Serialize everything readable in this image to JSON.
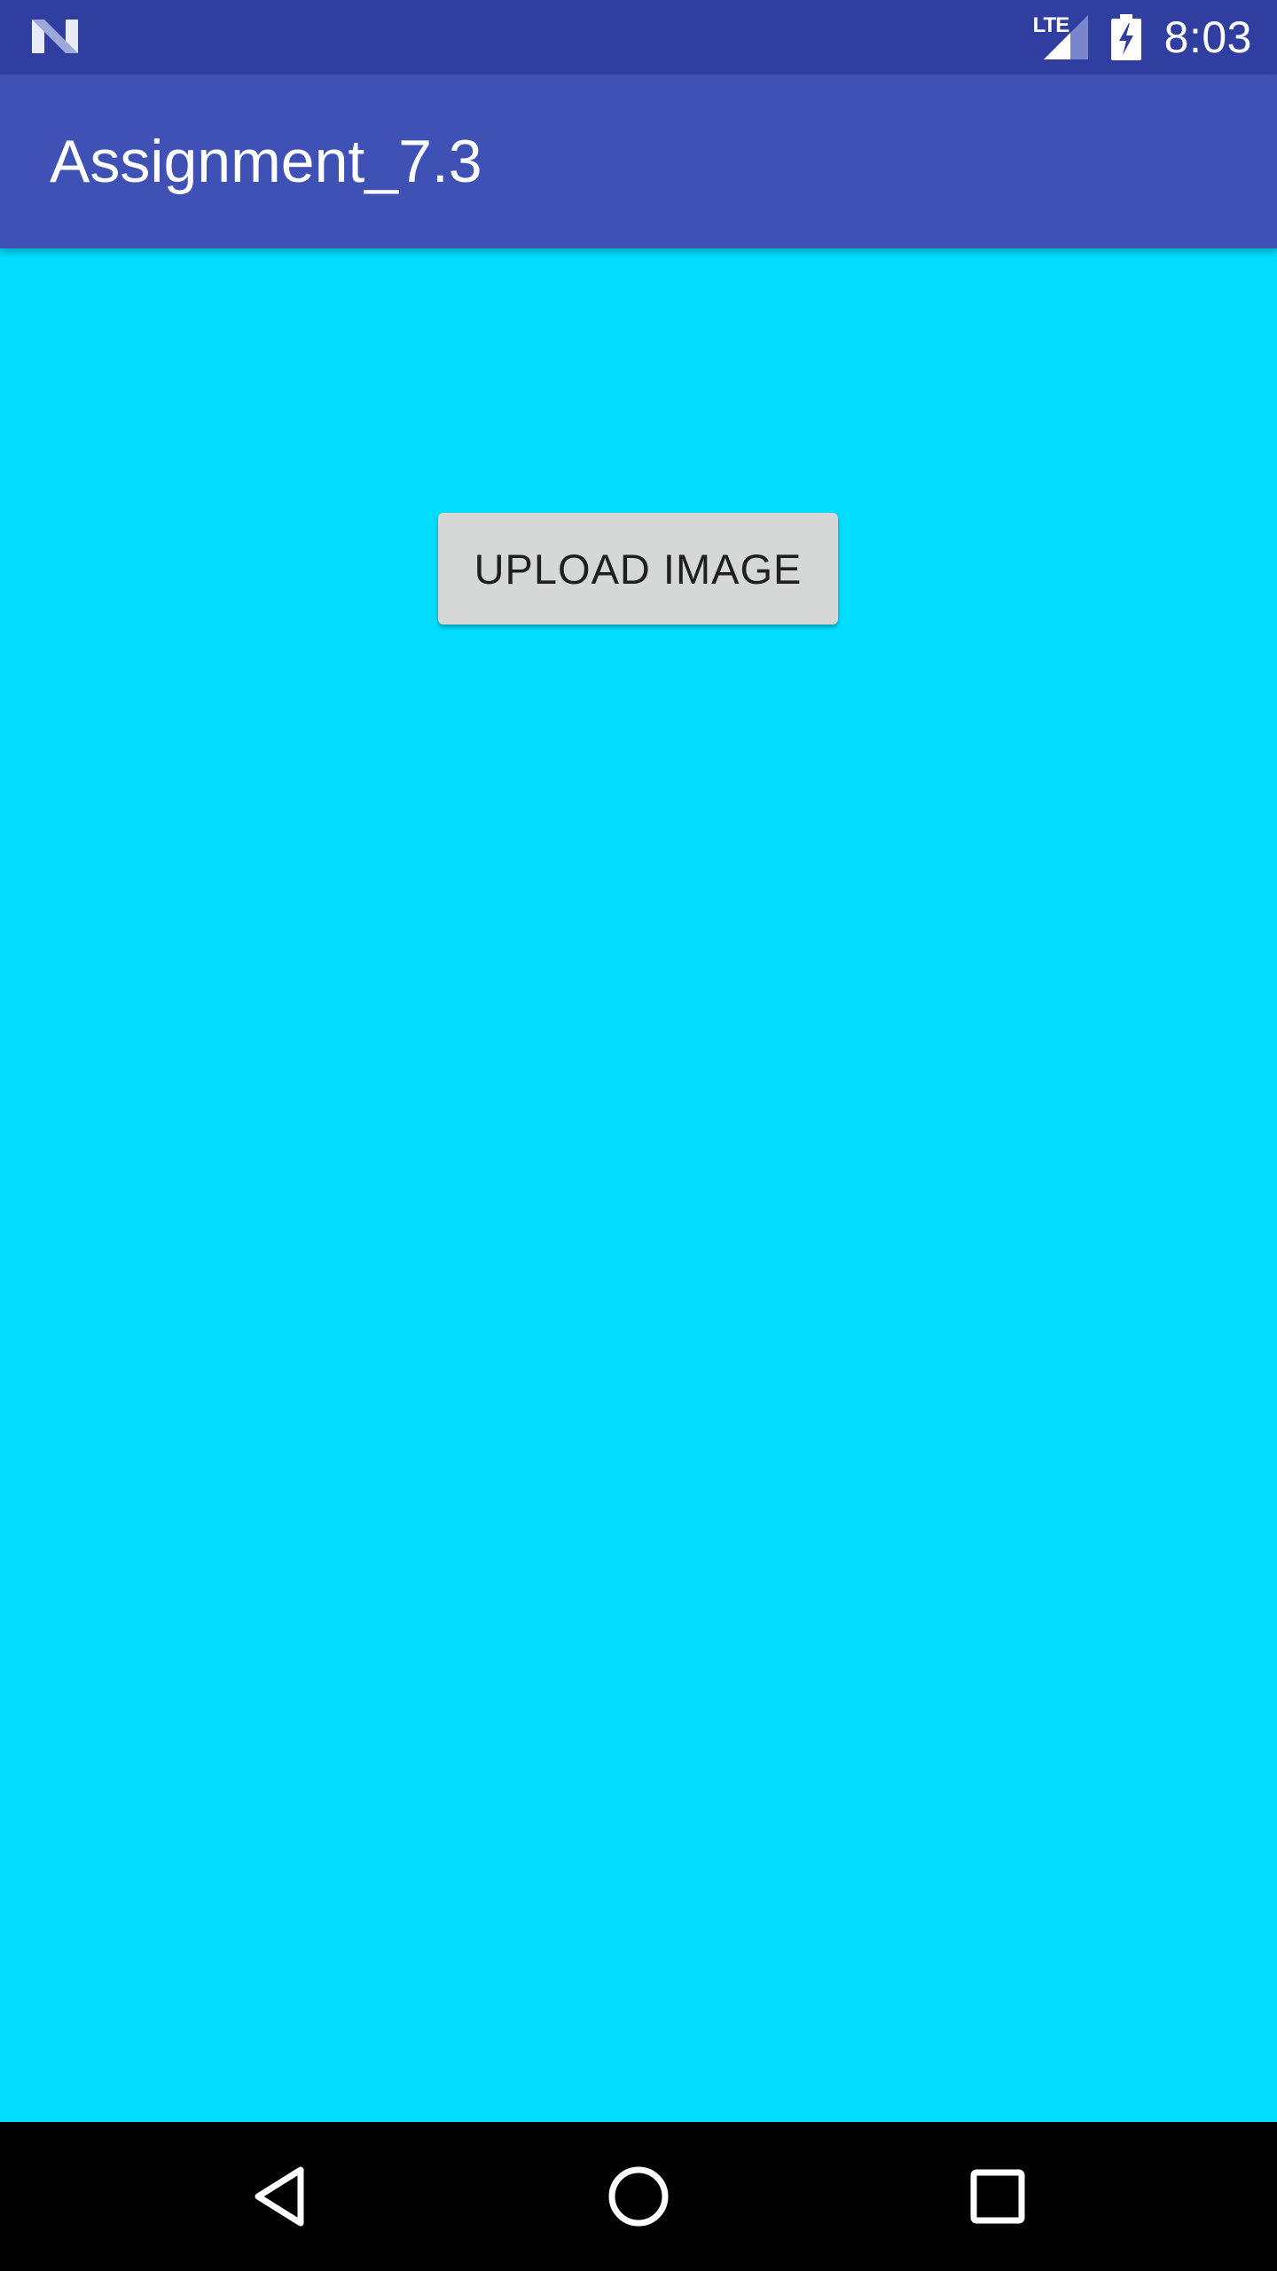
{
  "status_bar": {
    "notification_icon": "android-n-icon",
    "network_label": "LTE",
    "signal_icon": "signal-icon",
    "battery_icon": "battery-charging-icon",
    "time": "8:03"
  },
  "app_bar": {
    "title": "Assignment_7.3"
  },
  "main": {
    "upload_button_label": "UPLOAD IMAGE"
  },
  "nav_bar": {
    "back_icon": "back-icon",
    "home_icon": "home-icon",
    "recents_icon": "recents-icon"
  },
  "colors": {
    "status_bar": "#303F9F",
    "app_bar": "#3F51B5",
    "background": "#00DDFF",
    "button": "#D6D7D7",
    "nav_bar": "#000000"
  }
}
